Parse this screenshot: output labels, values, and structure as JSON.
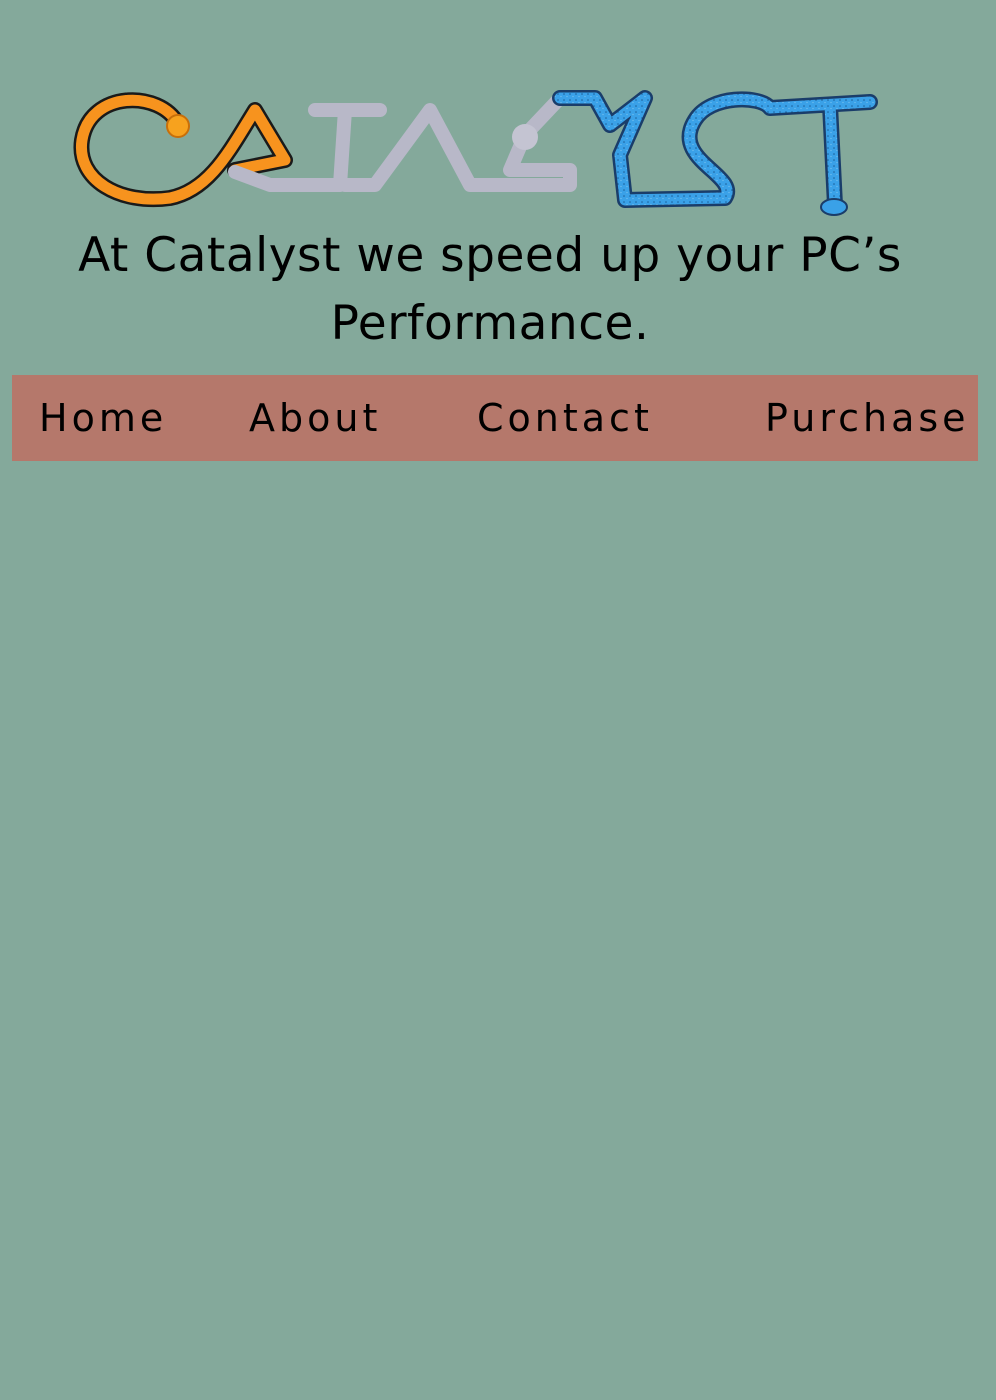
{
  "logo": {
    "name": "Catalyst",
    "colors": {
      "orange": "#f7931e",
      "gray": "#b8b8c8",
      "blue": "#3aa1e8",
      "outline": "#1a1a1a"
    }
  },
  "tagline": "At Catalyst we speed up your PC’s Performance.",
  "nav": {
    "items": [
      {
        "label": "Home"
      },
      {
        "label": "About"
      },
      {
        "label": "Contact"
      },
      {
        "label": "Purchase"
      }
    ],
    "background": "#b5786b"
  },
  "page": {
    "background": "#84a99b"
  }
}
